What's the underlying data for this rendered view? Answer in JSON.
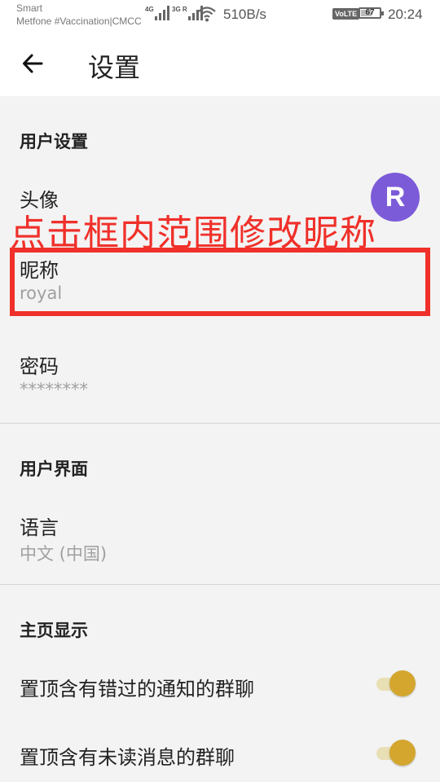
{
  "status_bar": {
    "carrier_line1": "Smart",
    "carrier_line2": "Metfone #Vaccination|CMCC",
    "signal1_label": "4G",
    "signal2_label": "3G R",
    "net_speed": "510B/s",
    "volte_label": "VoLTE",
    "battery_level": "67",
    "time": "20:24"
  },
  "app_bar": {
    "back_icon": "arrow-left-icon",
    "title": "设置"
  },
  "sections": {
    "user_settings": {
      "header": "用户设置",
      "avatar": {
        "title": "头像",
        "initial": "R",
        "color": "#7c5bd9"
      },
      "nickname": {
        "title": "昵称",
        "value": "royal"
      },
      "password": {
        "title": "密码",
        "value": "********"
      }
    },
    "user_interface": {
      "header": "用户界面",
      "language": {
        "title": "语言",
        "value": "中文 (中国)"
      }
    },
    "home_display": {
      "header": "主页显示",
      "pin_missed_notifications": {
        "title": "置顶含有错过的通知的群聊",
        "enabled": true
      },
      "pin_unread_messages": {
        "title": "置顶含有未读消息的群聊",
        "enabled": true
      }
    }
  },
  "annotation": {
    "text": "点击框内范围修改昵称",
    "color": "#f0302a"
  },
  "colors": {
    "accent": "#d4a62e",
    "switch_track": "#e8dfb4",
    "background": "#f3f3f3"
  }
}
